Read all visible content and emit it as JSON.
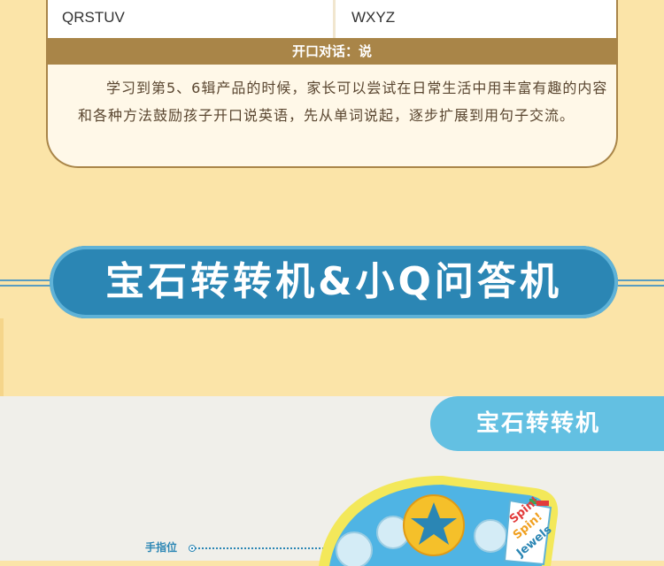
{
  "table": {
    "row_cells": [
      "QRSTUV",
      "WXYZ"
    ],
    "section_title": "开口对话：说",
    "section_text": "学习到第5、6辑产品的时候，家长可以尝试在日常生活中用丰富有趣的内容和各种方法鼓励孩子开口说英语，先从单词说起，逐步扩展到用句子交流。"
  },
  "banner": {
    "title": "宝石转转机&小Q问答机"
  },
  "product": {
    "tab_title": "宝石转转机",
    "callout_label": "手指位",
    "toy_text": [
      "Spin!",
      "Spin!",
      "Jewels"
    ]
  },
  "colors": {
    "page_bg": "#fbe4a8",
    "card_bg": "#fff8e8",
    "header_brown": "#a98548",
    "banner_blue": "#2b86b4",
    "tab_blue": "#63c0e2",
    "bottom_bg": "#f0efea"
  }
}
